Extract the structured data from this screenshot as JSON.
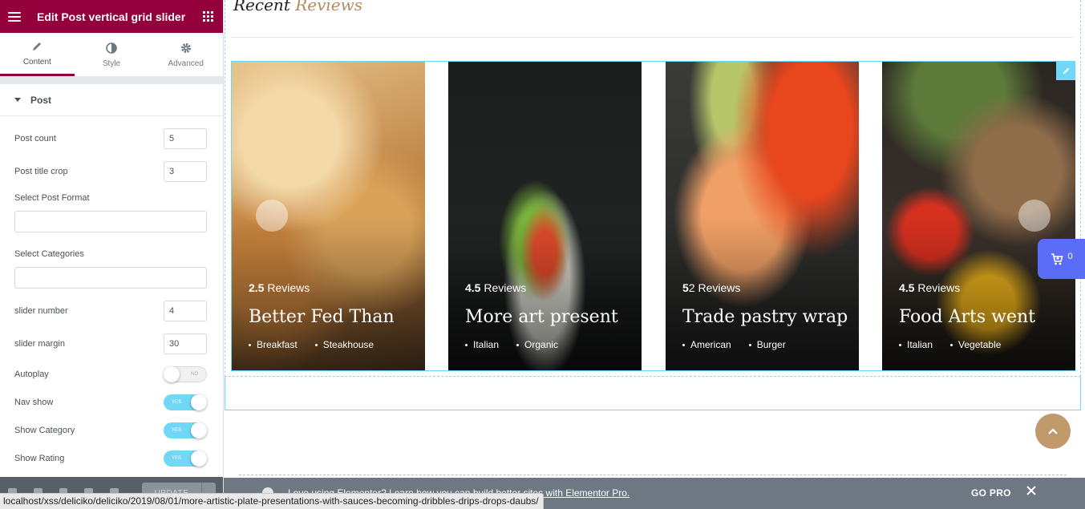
{
  "editor": {
    "title": "Edit Post vertical grid slider",
    "tabs": [
      {
        "label": "Content",
        "icon": "pencil-icon"
      },
      {
        "label": "Style",
        "icon": "half-circle-icon"
      },
      {
        "label": "Advanced",
        "icon": "gear-icon"
      }
    ],
    "section_title": "Post",
    "controls": {
      "post_count": {
        "label": "Post count",
        "value": "5"
      },
      "post_title_crop": {
        "label": "Post title crop",
        "value": "3"
      },
      "select_post_format": {
        "label": "Select Post Format"
      },
      "select_categories": {
        "label": "Select Categories"
      },
      "slider_number": {
        "label": "slider number",
        "value": "4"
      },
      "slider_margin": {
        "label": "slider margin",
        "value": "30"
      },
      "autoplay": {
        "label": "Autoplay",
        "state": "NO"
      },
      "nav_show": {
        "label": "Nav show",
        "state": "YES"
      },
      "show_category": {
        "label": "Show Category",
        "state": "YES"
      },
      "show_rating": {
        "label": "Show Rating",
        "state": "YES"
      }
    },
    "footer": {
      "update_label": "UPDATE"
    }
  },
  "page": {
    "heading_part1": "Recent",
    "heading_part2": "Reviews",
    "cards": [
      {
        "rating": "2.5",
        "rating_suffix": " Reviews",
        "title": "Better Fed Than",
        "categories": [
          "Breakfast",
          "Steakhouse"
        ]
      },
      {
        "rating": "4.5",
        "rating_suffix": " Reviews",
        "title": "More art present",
        "categories": [
          "Italian",
          "Organic"
        ]
      },
      {
        "rating": "5",
        "rating_suffix": "2 Reviews",
        "title": "Trade pastry wrap",
        "categories": [
          "American",
          "Burger"
        ]
      },
      {
        "rating": "4.5",
        "rating_suffix": " Reviews",
        "title": "Food Arts went",
        "categories": [
          "Italian",
          "Vegetable"
        ]
      }
    ],
    "cart_count": "0"
  },
  "notice": {
    "text": "Love using Elementor? Learn how you can build better sites with Elementor Pro.",
    "go_pro": "GO PRO"
  },
  "status_url": "localhost/xss/deliciko/deliciko/2019/08/01/more-artistic-plate-presentations-with-sauces-becoming-dribbles-drips-drops-daubs/",
  "colors": {
    "brand": "#93003c",
    "accent": "#71d7f7",
    "gold": "#c19a6b",
    "cart": "#5b6cf6"
  }
}
